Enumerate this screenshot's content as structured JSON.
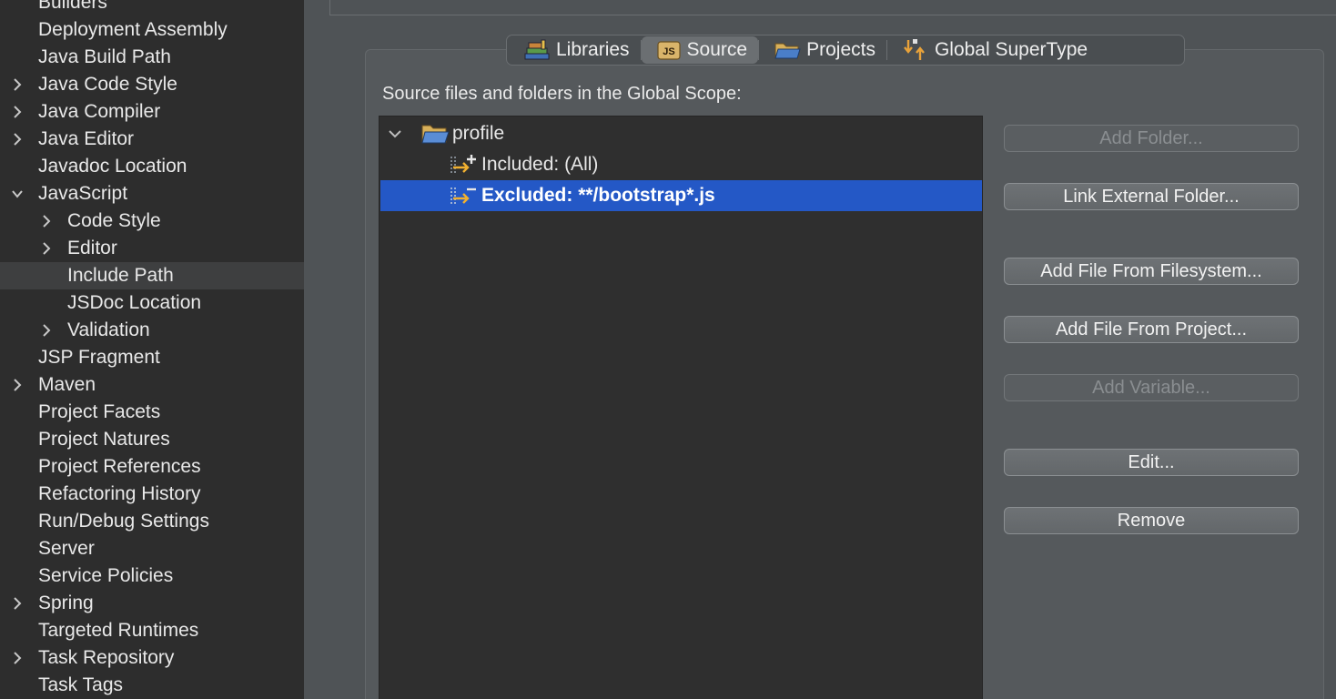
{
  "sidebar": {
    "items": [
      {
        "label": "Builders",
        "level": 0,
        "expandable": false,
        "expanded": false,
        "selected": false
      },
      {
        "label": "Deployment Assembly",
        "level": 0,
        "expandable": false,
        "expanded": false,
        "selected": false
      },
      {
        "label": "Java Build Path",
        "level": 0,
        "expandable": false,
        "expanded": false,
        "selected": false
      },
      {
        "label": "Java Code Style",
        "level": 0,
        "expandable": true,
        "expanded": false,
        "selected": false
      },
      {
        "label": "Java Compiler",
        "level": 0,
        "expandable": true,
        "expanded": false,
        "selected": false
      },
      {
        "label": "Java Editor",
        "level": 0,
        "expandable": true,
        "expanded": false,
        "selected": false
      },
      {
        "label": "Javadoc Location",
        "level": 0,
        "expandable": false,
        "expanded": false,
        "selected": false
      },
      {
        "label": "JavaScript",
        "level": 0,
        "expandable": true,
        "expanded": true,
        "selected": false
      },
      {
        "label": "Code Style",
        "level": 1,
        "expandable": true,
        "expanded": false,
        "selected": false
      },
      {
        "label": "Editor",
        "level": 1,
        "expandable": true,
        "expanded": false,
        "selected": false
      },
      {
        "label": "Include Path",
        "level": 1,
        "expandable": false,
        "expanded": false,
        "selected": true
      },
      {
        "label": "JSDoc Location",
        "level": 1,
        "expandable": false,
        "expanded": false,
        "selected": false
      },
      {
        "label": "Validation",
        "level": 1,
        "expandable": true,
        "expanded": false,
        "selected": false
      },
      {
        "label": "JSP Fragment",
        "level": 0,
        "expandable": false,
        "expanded": false,
        "selected": false
      },
      {
        "label": "Maven",
        "level": 0,
        "expandable": true,
        "expanded": false,
        "selected": false
      },
      {
        "label": "Project Facets",
        "level": 0,
        "expandable": false,
        "expanded": false,
        "selected": false
      },
      {
        "label": "Project Natures",
        "level": 0,
        "expandable": false,
        "expanded": false,
        "selected": false
      },
      {
        "label": "Project References",
        "level": 0,
        "expandable": false,
        "expanded": false,
        "selected": false
      },
      {
        "label": "Refactoring History",
        "level": 0,
        "expandable": false,
        "expanded": false,
        "selected": false
      },
      {
        "label": "Run/Debug Settings",
        "level": 0,
        "expandable": false,
        "expanded": false,
        "selected": false
      },
      {
        "label": "Server",
        "level": 0,
        "expandable": false,
        "expanded": false,
        "selected": false
      },
      {
        "label": "Service Policies",
        "level": 0,
        "expandable": false,
        "expanded": false,
        "selected": false
      },
      {
        "label": "Spring",
        "level": 0,
        "expandable": true,
        "expanded": false,
        "selected": false
      },
      {
        "label": "Targeted Runtimes",
        "level": 0,
        "expandable": false,
        "expanded": false,
        "selected": false
      },
      {
        "label": "Task Repository",
        "level": 0,
        "expandable": true,
        "expanded": false,
        "selected": false
      },
      {
        "label": "Task Tags",
        "level": 0,
        "expandable": false,
        "expanded": false,
        "selected": false
      }
    ]
  },
  "tabs": [
    {
      "label": "Libraries",
      "icon": "libraries-icon",
      "active": false
    },
    {
      "label": "Source",
      "icon": "js-source-icon",
      "active": true
    },
    {
      "label": "Projects",
      "icon": "projects-folder-icon",
      "active": false
    },
    {
      "label": "Global SuperType",
      "icon": "supertype-icon",
      "active": false
    }
  ],
  "source": {
    "label": "Source files and folders in the Global Scope:",
    "tree": [
      {
        "label": "profile",
        "icon": "open-folder-icon",
        "level": 0,
        "expanded": true,
        "selected": false
      },
      {
        "label": "Included: (All)",
        "icon": "inclusion-filter-icon",
        "level": 1,
        "selected": false
      },
      {
        "label": "Excluded: **/bootstrap*.js",
        "icon": "exclusion-filter-icon",
        "level": 1,
        "selected": true
      }
    ]
  },
  "buttons": {
    "add_folder": "Add Folder...",
    "link_external_folder": "Link External Folder...",
    "add_file_filesystem": "Add File From Filesystem...",
    "add_file_project": "Add File From Project...",
    "add_variable": "Add Variable...",
    "edit": "Edit...",
    "remove": "Remove"
  },
  "colors": {
    "selection": "#2458c6",
    "sidebar_bg": "#2d2d2d",
    "panel_bg": "#4f5356"
  }
}
